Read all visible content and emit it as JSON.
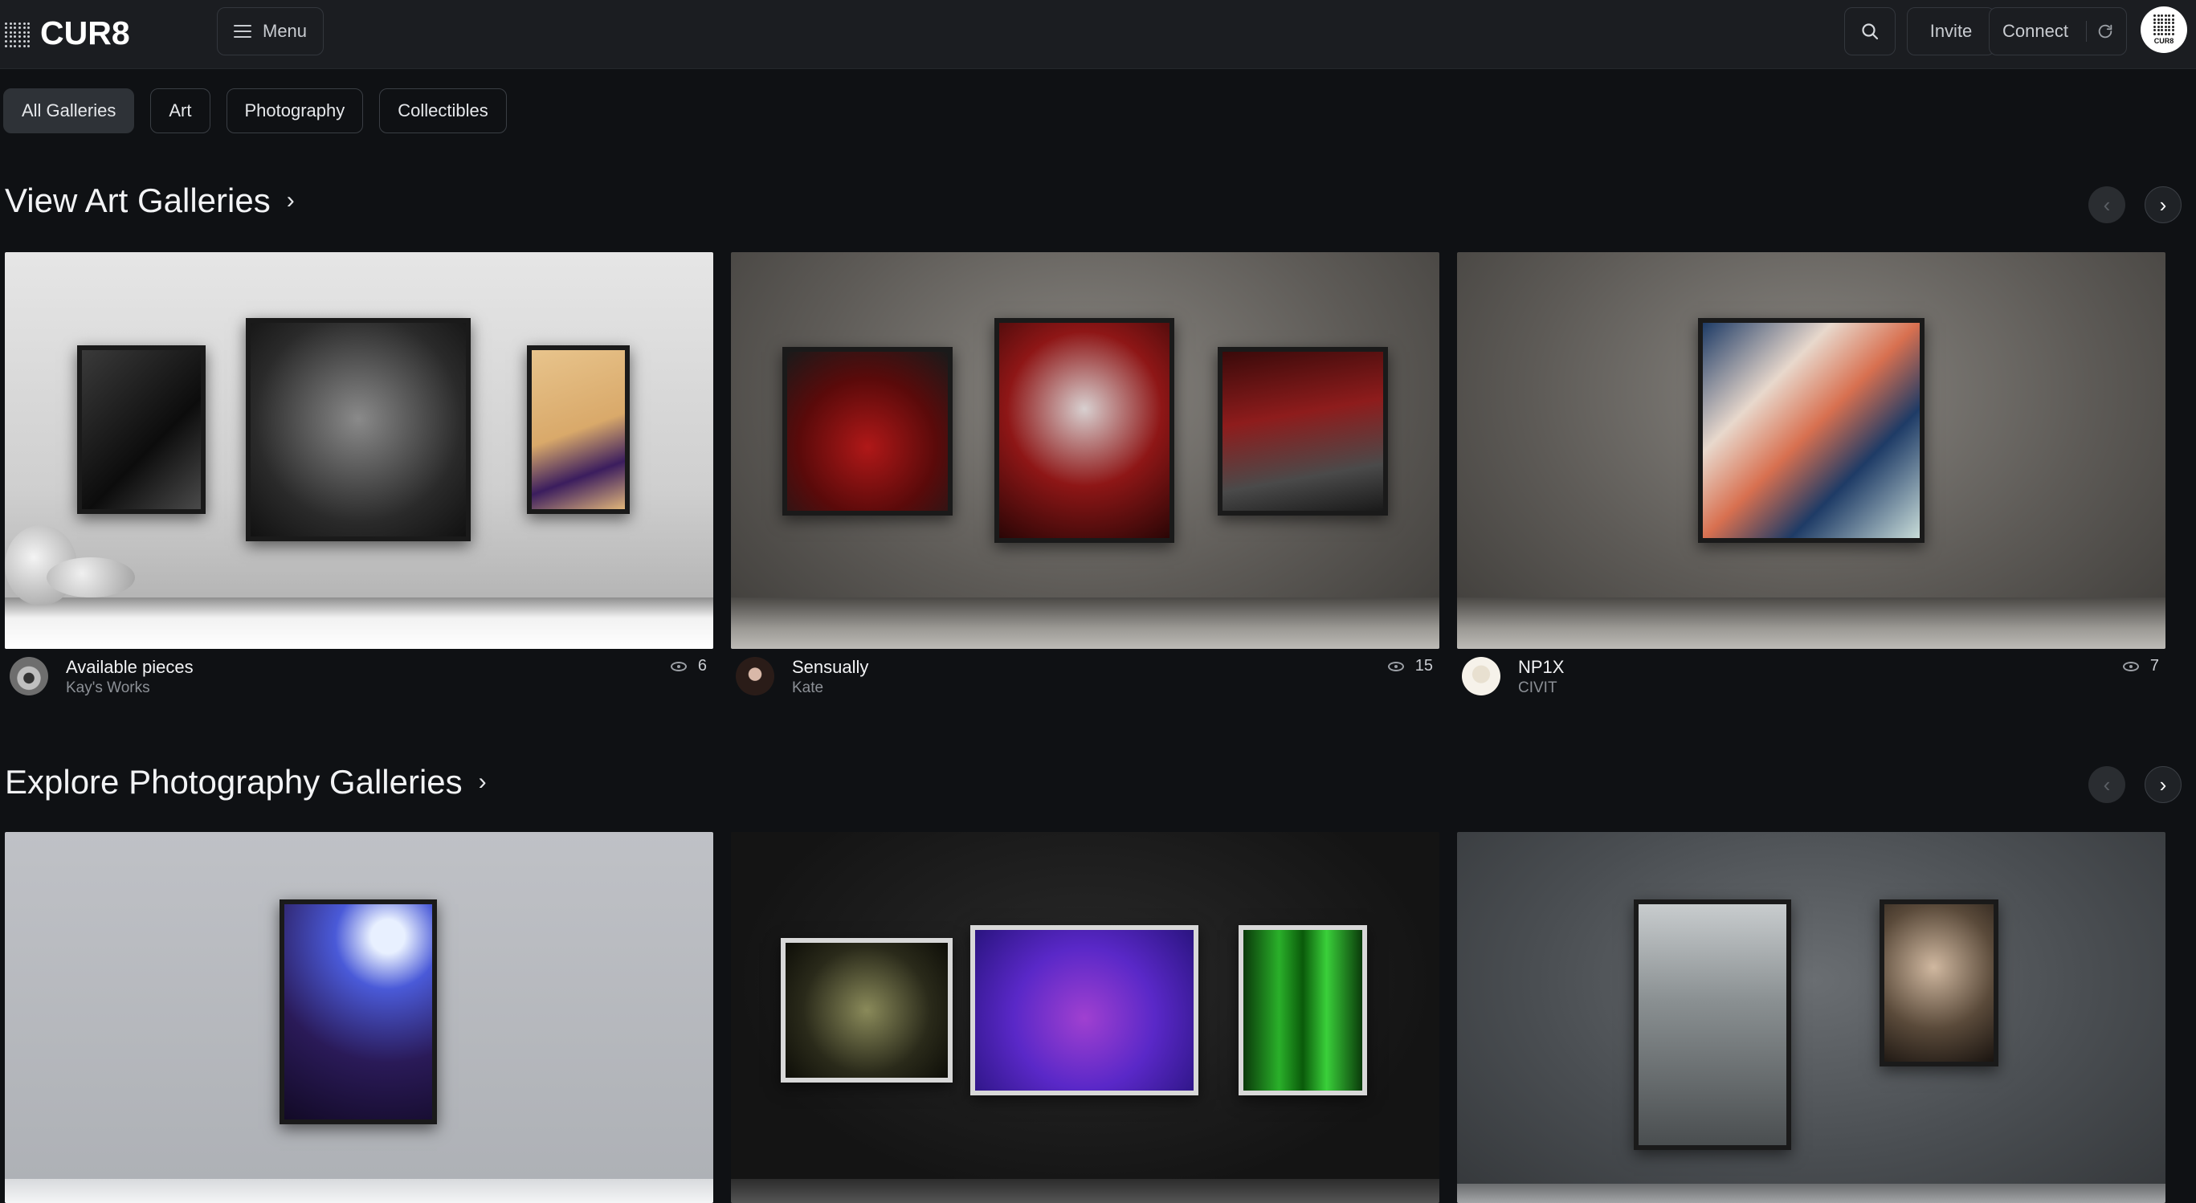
{
  "header": {
    "logo_text": "CUR8",
    "menu_label": "Menu",
    "invite_label": "Invite",
    "connect_label": "Connect",
    "avatar_text": "CUR8"
  },
  "filters": [
    "All Galleries",
    "Art",
    "Photography",
    "Collectibles"
  ],
  "art_section": {
    "title": "View Art Galleries",
    "cards": [
      {
        "name": "Available pieces",
        "owner": "Kay's Works",
        "views": "6"
      },
      {
        "name": "Sensually",
        "owner": "Kate",
        "views": "15"
      },
      {
        "name": "NP1X",
        "owner": "CIVIT",
        "views": "7"
      }
    ]
  },
  "photo_section": {
    "title": "Explore Photography Galleries"
  },
  "icons": {
    "search": "search-icon",
    "menu": "hamburger-icon",
    "refresh": "refresh-icon",
    "eye": "eye-icon",
    "chevron_right": "chevron-right-icon",
    "chevron_left": "chevron-left-icon"
  }
}
